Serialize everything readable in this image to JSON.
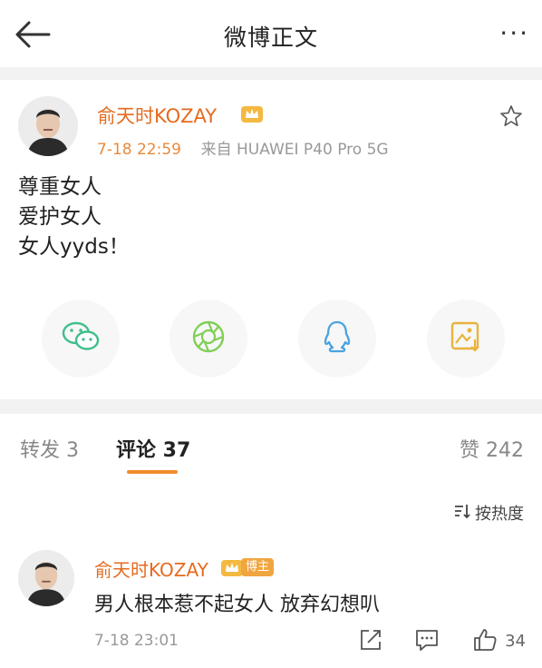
{
  "header": {
    "title": "微博正文",
    "more": "···"
  },
  "post": {
    "author": "俞天时KOZAY",
    "time": "7-18 22:59",
    "source": "来自 HUAWEI P40 Pro 5G",
    "lines": [
      "尊重女人",
      "爱护女人",
      "女人yyds！"
    ]
  },
  "share": {
    "icons": [
      "wechat-icon",
      "moments-icon",
      "qq-icon",
      "save-image-icon"
    ],
    "colors": {
      "wechat": "#3ebf8b",
      "moments": "#7fcf55",
      "qq": "#4aa3df",
      "save": "#e8b33c"
    }
  },
  "tabs": {
    "repost": "转发 3",
    "comment": "评论 37",
    "like": "赞 242"
  },
  "sort": {
    "label": "按热度"
  },
  "comment": {
    "author": "俞天时KOZAY",
    "badge": "博主",
    "text": "男人根本惹不起女人 放弃幻想叭",
    "time": "7-18 23:01",
    "likes": "34"
  },
  "colors": {
    "accent": "#f08c2d",
    "username": "#e56b1f"
  }
}
